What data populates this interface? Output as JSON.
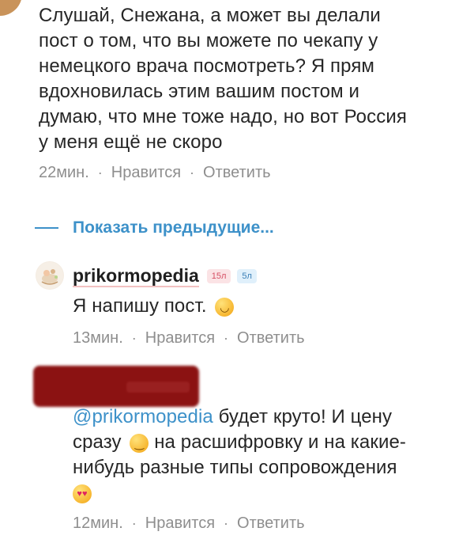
{
  "comment1": {
    "lines": [
      "Слушай, Снежана, а может вы делали",
      "пост о том, что вы можете по чекапу у",
      "немецкого врача посмотреть? Я прям",
      "вдохновилась этим вашим постом и",
      "думаю, что мне тоже надо, но вот Россия",
      "у меня ещё не скоро"
    ],
    "time": "22мин.",
    "like": "Нравится",
    "reply": "Ответить",
    "separator": "·"
  },
  "show_previous": {
    "label": "Показать предыдущие..."
  },
  "reply1": {
    "username": "prikormopedia",
    "badge_age1": "15л",
    "badge_age2": "5л",
    "text": "Я напишу пост.",
    "emoji": "smiling-face-emoji",
    "time": "13мин.",
    "like": "Нравится",
    "reply": "Ответить",
    "separator": "·"
  },
  "reply2": {
    "mention": "@prikormopedia",
    "text_line1_rest": " будет круто! И цену",
    "text_line2_start": "сразу ",
    "text_line2_end": " на расшифровку и на какие-",
    "text_line3": "нибудь разные типы сопровождения",
    "emoji_smirk": "smirking-face-emoji",
    "emoji_hearts": "heart-eyes-emoji",
    "time": "12мин.",
    "like": "Нравится",
    "reply": "Ответить",
    "separator": "·"
  },
  "colors": {
    "link_blue": "#3d91c9",
    "meta_gray": "#8e8e8e",
    "redaction_red": "#8b1212"
  }
}
